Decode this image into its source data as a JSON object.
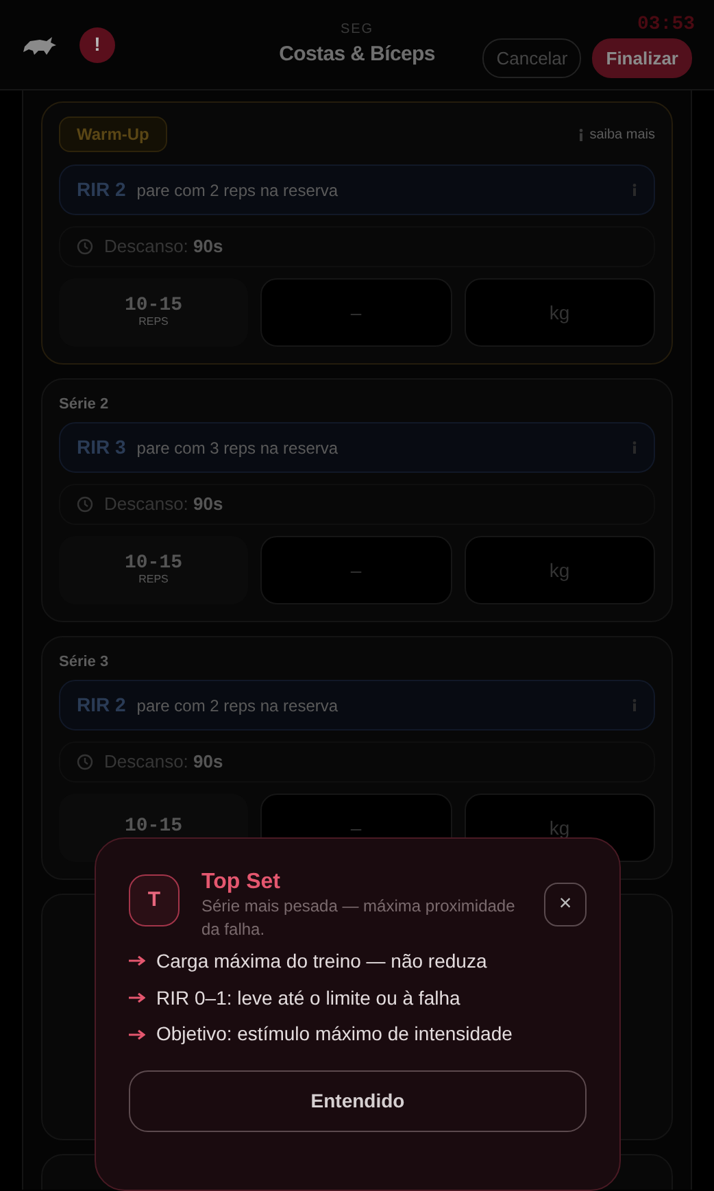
{
  "header": {
    "alert": "!",
    "day": "SEG",
    "title": "Costas & Bíceps",
    "timer": "03:53",
    "buttons": [
      {
        "label": "Cancelar",
        "kind": "outline"
      },
      {
        "label": "Finalizar",
        "kind": "primary"
      }
    ]
  },
  "sets": [
    {
      "kind": "warmup",
      "badge": "Warm-Up",
      "info": "saiba mais",
      "rir": "RIR 2",
      "rir_hint": "pare com 2 reps na reserva",
      "rest_label": "Descanso:",
      "rest_value": "90s",
      "reps": "10-15",
      "reps_label": "REPS",
      "load_placeholder": "–",
      "weight_placeholder": "kg"
    },
    {
      "kind": "normal",
      "label": "Série 2",
      "rir": "RIR 3",
      "rir_hint": "pare com 3 reps na reserva",
      "rest_label": "Descanso:",
      "rest_value": "90s",
      "reps": "10-15",
      "reps_label": "REPS",
      "load_placeholder": "–",
      "weight_placeholder": "kg"
    },
    {
      "kind": "normal",
      "label": "Série 3",
      "rir": "RIR 2",
      "rir_hint": "pare com 2 reps na reserva",
      "rest_label": "Descanso:",
      "rest_value": "90s",
      "reps": "10-15",
      "load_placeholder": "–",
      "weight_placeholder": "kg"
    },
    {
      "kind": "covered"
    },
    {
      "kind": "covered"
    }
  ],
  "dialog": {
    "avatar": "T",
    "title": "Top Set",
    "subtitle": "Série mais pesada — máxima proximidade da falha.",
    "close": "×",
    "points": [
      "Carga máxima do treino — não reduza",
      "RIR 0–1: leve até o limite ou à falha",
      "Objetivo: estímulo máximo de intensidade"
    ],
    "button": "Entendido"
  }
}
